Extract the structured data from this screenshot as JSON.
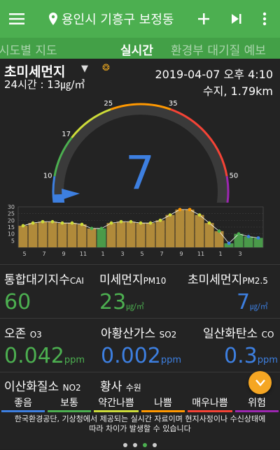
{
  "header": {
    "location": "용인시 기흥구 보정동",
    "icons": [
      "menu-icon",
      "location-pin-icon",
      "add-icon",
      "skip-next-icon",
      "more-vert-icon"
    ],
    "color": "#4caf50"
  },
  "tabs": [
    {
      "label": "시도별 지도",
      "active": false
    },
    {
      "label": "실시간",
      "active": true
    },
    {
      "label": "환경부 대기질 예보",
      "active": false
    }
  ],
  "pollutant": {
    "title": "초미세먼지",
    "avg24h": "24시간 : 13㎍/㎥",
    "datetime": "2019-04-07 오후 4:10",
    "station": "수지, 1.79km"
  },
  "gauge": {
    "value": "7",
    "ticks": [
      "10",
      "17",
      "25",
      "35",
      "50"
    ],
    "value_num": 7,
    "max": 60,
    "color": "#3d7fe0"
  },
  "hourly": {
    "y_ticks": [
      "30",
      "25",
      "20",
      "15",
      "10",
      "5"
    ],
    "x_labels": [
      "5",
      "7",
      "9",
      "11",
      "1",
      "3",
      "5",
      "7",
      "9",
      "11",
      "1",
      "3"
    ],
    "values": [
      16,
      18,
      19,
      19,
      18,
      18,
      17,
      14,
      14,
      18,
      19,
      19,
      18,
      18,
      20,
      24,
      28,
      28,
      24,
      18,
      12,
      3,
      10,
      8,
      7
    ],
    "bar_colors": [
      "#b08a3a",
      "#b08a3a",
      "#b08a3a",
      "#b08a3a",
      "#b08a3a",
      "#b08a3a",
      "#b08a3a",
      "#b08a3a",
      "#4a9a4a",
      "#b08a3a",
      "#b08a3a",
      "#b08a3a",
      "#b08a3a",
      "#b08a3a",
      "#b08a3a",
      "#b08a3a",
      "#b08a3a",
      "#b08a3a",
      "#b08a3a",
      "#b08a3a",
      "#b08a3a",
      "#4a9a4a",
      "#4a9a4a",
      "#4a9a4a",
      "#4a9a4a"
    ]
  },
  "stats": [
    {
      "label": "통합대기지수",
      "code": "CAI",
      "value": "60",
      "unit": "",
      "color": "#4caf50"
    },
    {
      "label": "미세먼지",
      "code": "PM10",
      "value": "23",
      "unit": "㎍/㎥",
      "color": "#4caf50"
    },
    {
      "label": "초미세먼지",
      "code": "PM2.5",
      "value": "7",
      "unit": "㎍/㎥",
      "color": "#3d7fe0"
    },
    {
      "label": "오존",
      "code": "O3",
      "value": "0.042",
      "unit": "ppm",
      "color": "#4caf50"
    },
    {
      "label": "아황산가스",
      "code": "SO2",
      "value": "0.002",
      "unit": "ppm",
      "color": "#3d7fe0"
    },
    {
      "label": "일산화탄소",
      "code": "CO",
      "value": "0.3",
      "unit": "ppm",
      "color": "#3d7fe0"
    },
    {
      "label": "이산화질소",
      "code": "NO2",
      "value": "",
      "unit": "",
      "color": "#ffffff"
    },
    {
      "label": "황사",
      "code": "수원",
      "value": "",
      "unit": "",
      "color": "#ffffff"
    }
  ],
  "legend": [
    {
      "label": "좋음",
      "color": "#3d7fe0"
    },
    {
      "label": "보통",
      "color": "#4caf50"
    },
    {
      "label": "약간나쁨",
      "color": "#cddc39"
    },
    {
      "label": "나쁨",
      "color": "#ff9800"
    },
    {
      "label": "매우나쁨",
      "color": "#f44336"
    },
    {
      "label": "위험",
      "color": "#9c27b0"
    }
  ],
  "footer": {
    "line1": "한국환경공단, 기상청에서 제공되는 실시간 자료이며 현지사정이나 수신상태에",
    "line2": "따라 차이가 발생할 수 있습니다"
  },
  "pager": {
    "count": 4,
    "active": 2
  }
}
